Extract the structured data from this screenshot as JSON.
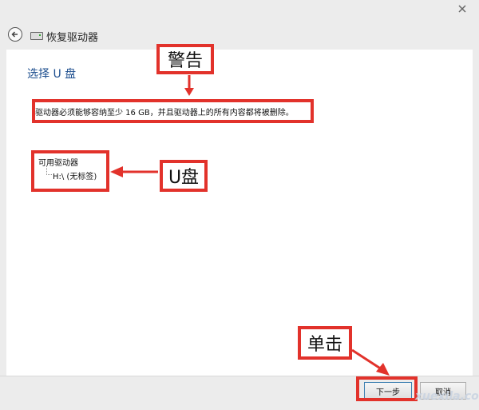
{
  "window": {
    "title": "恢复驱动器",
    "close_glyph": "✕"
  },
  "page": {
    "heading": "选择 U 盘",
    "warning": "驱动器必须能够容纳至少 16 GB，并且驱动器上的所有内容都将被删除。",
    "drives_label": "可用驱动器",
    "drives": [
      "H:\\ (无标签)"
    ]
  },
  "buttons": {
    "next_label": "下一步",
    "cancel_label": "取消"
  },
  "annotations": {
    "warning_callout": "警告",
    "usb_callout": "U盘",
    "click_callout": "单击",
    "color": "#e2322b"
  },
  "watermark": "xuexila.com",
  "icons": {
    "back": "back-arrow-icon",
    "drive": "drive-icon",
    "close": "close-icon"
  }
}
